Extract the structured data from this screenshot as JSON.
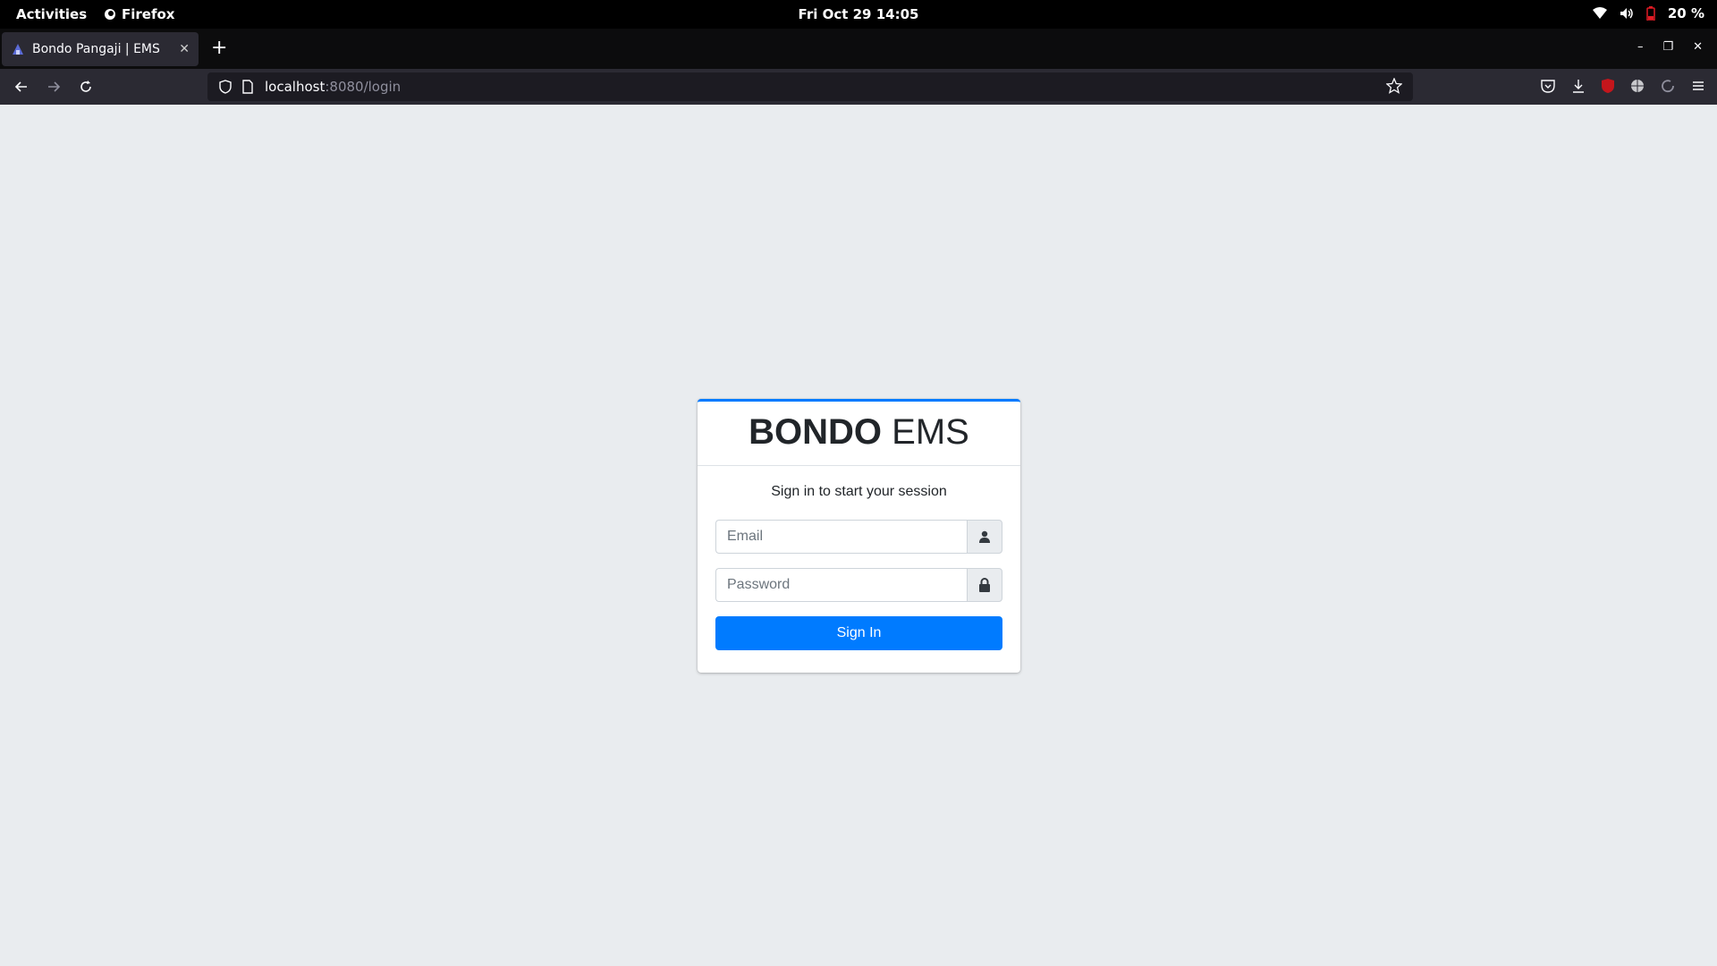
{
  "system_bar": {
    "activities": "Activities",
    "app_name": "Firefox",
    "clock": "Fri Oct 29  14:05",
    "battery": "20 %"
  },
  "browser": {
    "tab_title": "Bondo Pangaji | EMS",
    "url_host": "localhost",
    "url_path": ":8080/login"
  },
  "login": {
    "brand_bold": "BONDO",
    "brand_light": " EMS",
    "message": "Sign in to start your session",
    "email_placeholder": "Email",
    "password_placeholder": "Password",
    "submit_label": "Sign In"
  },
  "colors": {
    "accent": "#007bff",
    "page_bg": "#e9ecef",
    "battery_low": "#e01b24"
  },
  "icons": {
    "email_addon": "user-icon",
    "password_addon": "lock-icon"
  }
}
